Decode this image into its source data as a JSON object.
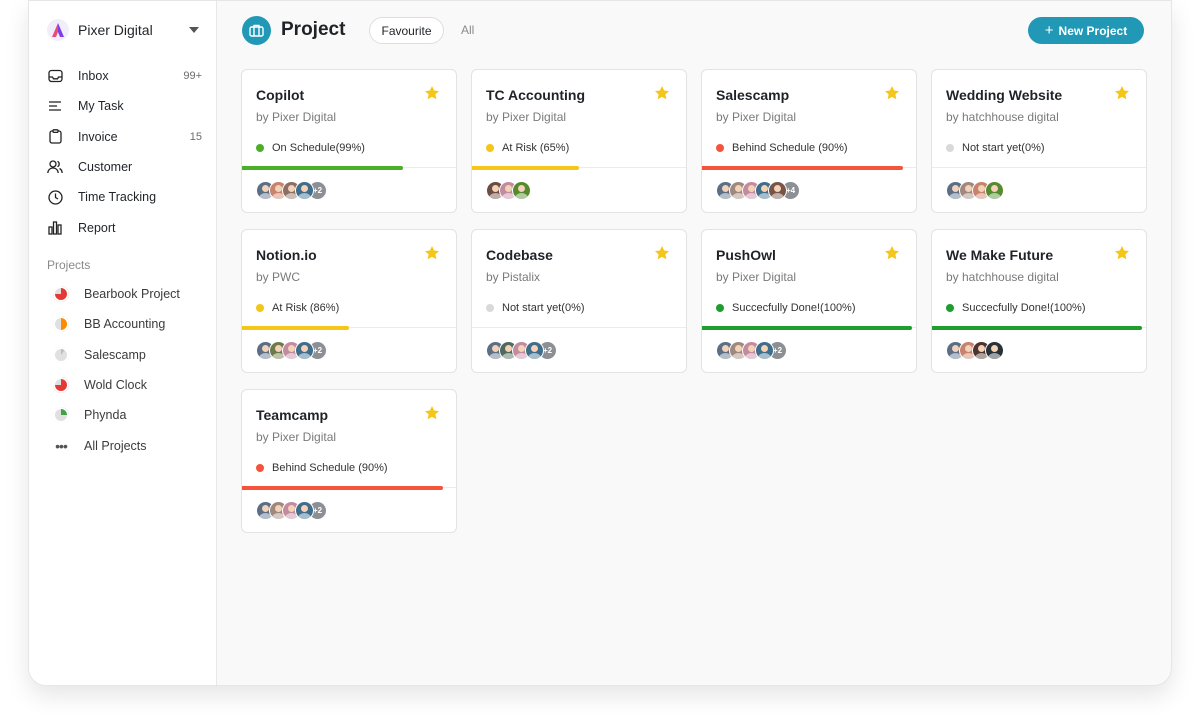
{
  "workspace": {
    "name": "Pixer Digital"
  },
  "nav": [
    {
      "label": "Inbox",
      "count": "99+",
      "icon": "inbox-icon"
    },
    {
      "label": "My Task",
      "count": "",
      "icon": "task-list-icon"
    },
    {
      "label": "Invoice",
      "count": "15",
      "icon": "clipboard-icon"
    },
    {
      "label": "Customer",
      "count": "",
      "icon": "users-icon"
    },
    {
      "label": "Time Tracking",
      "count": "",
      "icon": "clock-icon"
    },
    {
      "label": "Report",
      "count": "",
      "icon": "bar-chart-icon"
    }
  ],
  "projects_section": {
    "title": "Projects",
    "items": [
      {
        "label": "Bearbook Project",
        "color": "#e53935",
        "progress": 0.75
      },
      {
        "label": "BB Accounting",
        "color": "#fb8c00",
        "progress": 0.5
      },
      {
        "label": "Salescamp",
        "color": "#bdbdbd",
        "progress": 0.1
      },
      {
        "label": "Wold Clock",
        "color": "#e53935",
        "progress": 0.75
      },
      {
        "label": "Phynda",
        "color": "#43a047",
        "progress": 0.25
      }
    ],
    "all_label": "All Projects"
  },
  "header": {
    "title": "Project",
    "filters": [
      "Favourite",
      "All"
    ],
    "new_button": "New Project"
  },
  "colors": {
    "accent": "#2198b6",
    "star": "#f5c518"
  },
  "cards": [
    {
      "title": "Copilot",
      "owner": "by Pixer Digital",
      "status": "On Schedule(99%)",
      "progress": 0.75,
      "color": "#4caf2a",
      "avatars": [
        "#5b6e86",
        "#c9826b",
        "#8d6e63",
        "#3f6e8c"
      ],
      "more": "+2"
    },
    {
      "title": "TC Accounting",
      "owner": "by Pixer Digital",
      "status": "At Risk (65%)",
      "progress": 0.5,
      "color": "#f5c518",
      "avatars": [
        "#6d4c41",
        "#c48b9f",
        "#558b2f"
      ],
      "more": ""
    },
    {
      "title": "Salescamp",
      "owner": "by Pixer Digital",
      "status": "Behind Schedule (90%)",
      "progress": 0.94,
      "color": "#f4553a",
      "avatars": [
        "#5b6e86",
        "#a1887f",
        "#c48b9f",
        "#3f6e8c",
        "#795548"
      ],
      "more": "+4"
    },
    {
      "title": "Wedding Website",
      "owner": "by hatchhouse digital",
      "status": "Not start yet(0%)",
      "progress": 0,
      "color": "#d9d9d9",
      "avatars": [
        "#5b6e86",
        "#a1887f",
        "#c9826b",
        "#558b2f"
      ],
      "more": ""
    },
    {
      "title": "Notion.io",
      "owner": "by PWC",
      "status": "At Risk (86%)",
      "progress": 0.5,
      "color": "#f5c518",
      "avatars": [
        "#5b6e86",
        "#6d7b4b",
        "#c48b9f",
        "#3f6e8c"
      ],
      "more": "+2"
    },
    {
      "title": "Codebase",
      "owner": "by Pistalix",
      "status": "Not start yet(0%)",
      "progress": 0,
      "color": "#d9d9d9",
      "avatars": [
        "#5b6e86",
        "#4e6b5c",
        "#c48b9f",
        "#3f6e8c"
      ],
      "more": "+2"
    },
    {
      "title": "PushOwl",
      "owner": "by Pixer Digital",
      "status": "Succecfully Done!(100%)",
      "progress": 0.98,
      "color": "#1f9d2e",
      "avatars": [
        "#5b6e86",
        "#a1887f",
        "#c48b9f",
        "#3f6e8c"
      ],
      "more": "+2"
    },
    {
      "title": "We Make Future",
      "owner": "by hatchhouse digital",
      "status": "Succecfully Done!(100%)",
      "progress": 0.98,
      "color": "#1f9d2e",
      "avatars": [
        "#5b6e86",
        "#c9826b",
        "#4e342e",
        "#263238"
      ],
      "more": ""
    },
    {
      "title": "Teamcamp",
      "owner": "by Pixer Digital",
      "status": "Behind Schedule (90%)",
      "progress": 0.94,
      "color": "#f4553a",
      "avatars": [
        "#5b6e86",
        "#a1887f",
        "#c48b9f",
        "#3f6e8c"
      ],
      "more": "+2"
    }
  ]
}
